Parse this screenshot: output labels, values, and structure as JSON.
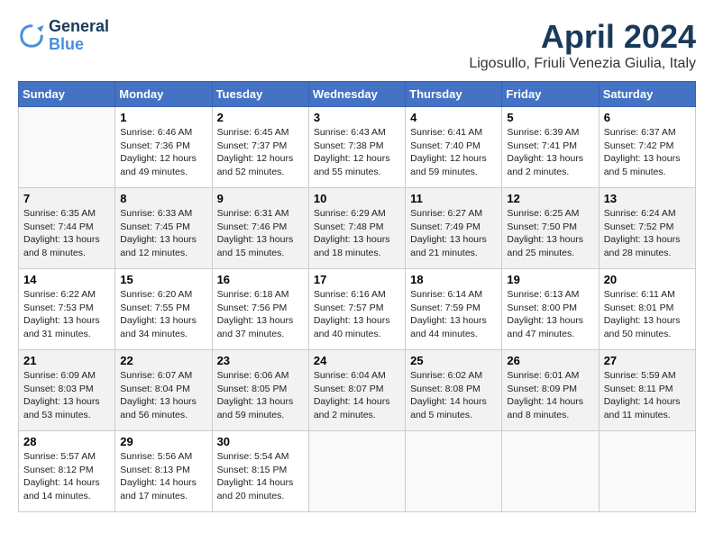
{
  "header": {
    "logo_line1": "General",
    "logo_line2": "Blue",
    "month_title": "April 2024",
    "location": "Ligosullo, Friuli Venezia Giulia, Italy"
  },
  "weekdays": [
    "Sunday",
    "Monday",
    "Tuesday",
    "Wednesday",
    "Thursday",
    "Friday",
    "Saturday"
  ],
  "weeks": [
    [
      {
        "day": "",
        "sunrise": "",
        "sunset": "",
        "daylight": ""
      },
      {
        "day": "1",
        "sunrise": "Sunrise: 6:46 AM",
        "sunset": "Sunset: 7:36 PM",
        "daylight": "Daylight: 12 hours and 49 minutes."
      },
      {
        "day": "2",
        "sunrise": "Sunrise: 6:45 AM",
        "sunset": "Sunset: 7:37 PM",
        "daylight": "Daylight: 12 hours and 52 minutes."
      },
      {
        "day": "3",
        "sunrise": "Sunrise: 6:43 AM",
        "sunset": "Sunset: 7:38 PM",
        "daylight": "Daylight: 12 hours and 55 minutes."
      },
      {
        "day": "4",
        "sunrise": "Sunrise: 6:41 AM",
        "sunset": "Sunset: 7:40 PM",
        "daylight": "Daylight: 12 hours and 59 minutes."
      },
      {
        "day": "5",
        "sunrise": "Sunrise: 6:39 AM",
        "sunset": "Sunset: 7:41 PM",
        "daylight": "Daylight: 13 hours and 2 minutes."
      },
      {
        "day": "6",
        "sunrise": "Sunrise: 6:37 AM",
        "sunset": "Sunset: 7:42 PM",
        "daylight": "Daylight: 13 hours and 5 minutes."
      }
    ],
    [
      {
        "day": "7",
        "sunrise": "Sunrise: 6:35 AM",
        "sunset": "Sunset: 7:44 PM",
        "daylight": "Daylight: 13 hours and 8 minutes."
      },
      {
        "day": "8",
        "sunrise": "Sunrise: 6:33 AM",
        "sunset": "Sunset: 7:45 PM",
        "daylight": "Daylight: 13 hours and 12 minutes."
      },
      {
        "day": "9",
        "sunrise": "Sunrise: 6:31 AM",
        "sunset": "Sunset: 7:46 PM",
        "daylight": "Daylight: 13 hours and 15 minutes."
      },
      {
        "day": "10",
        "sunrise": "Sunrise: 6:29 AM",
        "sunset": "Sunset: 7:48 PM",
        "daylight": "Daylight: 13 hours and 18 minutes."
      },
      {
        "day": "11",
        "sunrise": "Sunrise: 6:27 AM",
        "sunset": "Sunset: 7:49 PM",
        "daylight": "Daylight: 13 hours and 21 minutes."
      },
      {
        "day": "12",
        "sunrise": "Sunrise: 6:25 AM",
        "sunset": "Sunset: 7:50 PM",
        "daylight": "Daylight: 13 hours and 25 minutes."
      },
      {
        "day": "13",
        "sunrise": "Sunrise: 6:24 AM",
        "sunset": "Sunset: 7:52 PM",
        "daylight": "Daylight: 13 hours and 28 minutes."
      }
    ],
    [
      {
        "day": "14",
        "sunrise": "Sunrise: 6:22 AM",
        "sunset": "Sunset: 7:53 PM",
        "daylight": "Daylight: 13 hours and 31 minutes."
      },
      {
        "day": "15",
        "sunrise": "Sunrise: 6:20 AM",
        "sunset": "Sunset: 7:55 PM",
        "daylight": "Daylight: 13 hours and 34 minutes."
      },
      {
        "day": "16",
        "sunrise": "Sunrise: 6:18 AM",
        "sunset": "Sunset: 7:56 PM",
        "daylight": "Daylight: 13 hours and 37 minutes."
      },
      {
        "day": "17",
        "sunrise": "Sunrise: 6:16 AM",
        "sunset": "Sunset: 7:57 PM",
        "daylight": "Daylight: 13 hours and 40 minutes."
      },
      {
        "day": "18",
        "sunrise": "Sunrise: 6:14 AM",
        "sunset": "Sunset: 7:59 PM",
        "daylight": "Daylight: 13 hours and 44 minutes."
      },
      {
        "day": "19",
        "sunrise": "Sunrise: 6:13 AM",
        "sunset": "Sunset: 8:00 PM",
        "daylight": "Daylight: 13 hours and 47 minutes."
      },
      {
        "day": "20",
        "sunrise": "Sunrise: 6:11 AM",
        "sunset": "Sunset: 8:01 PM",
        "daylight": "Daylight: 13 hours and 50 minutes."
      }
    ],
    [
      {
        "day": "21",
        "sunrise": "Sunrise: 6:09 AM",
        "sunset": "Sunset: 8:03 PM",
        "daylight": "Daylight: 13 hours and 53 minutes."
      },
      {
        "day": "22",
        "sunrise": "Sunrise: 6:07 AM",
        "sunset": "Sunset: 8:04 PM",
        "daylight": "Daylight: 13 hours and 56 minutes."
      },
      {
        "day": "23",
        "sunrise": "Sunrise: 6:06 AM",
        "sunset": "Sunset: 8:05 PM",
        "daylight": "Daylight: 13 hours and 59 minutes."
      },
      {
        "day": "24",
        "sunrise": "Sunrise: 6:04 AM",
        "sunset": "Sunset: 8:07 PM",
        "daylight": "Daylight: 14 hours and 2 minutes."
      },
      {
        "day": "25",
        "sunrise": "Sunrise: 6:02 AM",
        "sunset": "Sunset: 8:08 PM",
        "daylight": "Daylight: 14 hours and 5 minutes."
      },
      {
        "day": "26",
        "sunrise": "Sunrise: 6:01 AM",
        "sunset": "Sunset: 8:09 PM",
        "daylight": "Daylight: 14 hours and 8 minutes."
      },
      {
        "day": "27",
        "sunrise": "Sunrise: 5:59 AM",
        "sunset": "Sunset: 8:11 PM",
        "daylight": "Daylight: 14 hours and 11 minutes."
      }
    ],
    [
      {
        "day": "28",
        "sunrise": "Sunrise: 5:57 AM",
        "sunset": "Sunset: 8:12 PM",
        "daylight": "Daylight: 14 hours and 14 minutes."
      },
      {
        "day": "29",
        "sunrise": "Sunrise: 5:56 AM",
        "sunset": "Sunset: 8:13 PM",
        "daylight": "Daylight: 14 hours and 17 minutes."
      },
      {
        "day": "30",
        "sunrise": "Sunrise: 5:54 AM",
        "sunset": "Sunset: 8:15 PM",
        "daylight": "Daylight: 14 hours and 20 minutes."
      },
      {
        "day": "",
        "sunrise": "",
        "sunset": "",
        "daylight": ""
      },
      {
        "day": "",
        "sunrise": "",
        "sunset": "",
        "daylight": ""
      },
      {
        "day": "",
        "sunrise": "",
        "sunset": "",
        "daylight": ""
      },
      {
        "day": "",
        "sunrise": "",
        "sunset": "",
        "daylight": ""
      }
    ]
  ]
}
